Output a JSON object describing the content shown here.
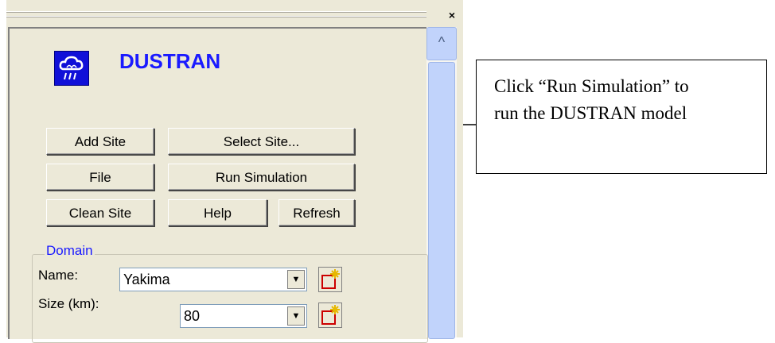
{
  "panel": {
    "close_glyph": "×",
    "scroll_up_glyph": "^"
  },
  "app": {
    "title": "DUSTRAN",
    "logo_icon": "cloud-rain-icon"
  },
  "buttons": {
    "add_site": "Add Site",
    "select_site": "Select Site...",
    "file": "File",
    "run_simulation": "Run Simulation",
    "clean_site": "Clean Site",
    "help": "Help",
    "refresh": "Refresh"
  },
  "domain": {
    "group_label": "Domain",
    "name_label": "Name:",
    "name_value": "Yakima",
    "size_label": "Size (km):",
    "size_value": "80",
    "dropdown_glyph": "▼"
  },
  "callout": {
    "line1": "Click “Run Simulation” to",
    "line2": "run the DUSTRAN model"
  },
  "colors": {
    "title_blue": "#1a1aff",
    "panel_bg": "#ece9d8",
    "scrollbar": "#c1d3fb"
  }
}
